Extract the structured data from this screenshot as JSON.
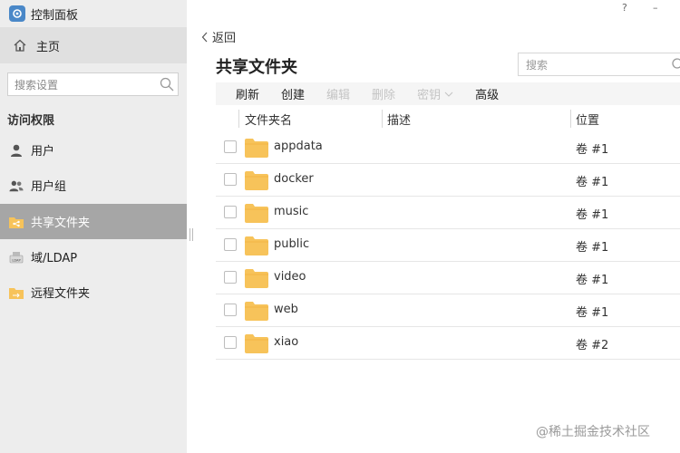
{
  "app": {
    "title": "控制面板",
    "icon": "control-panel-icon"
  },
  "sidebar": {
    "home_label": "主页",
    "search_placeholder": "搜索设置",
    "section_title": "访问权限",
    "items": [
      {
        "label": "用户",
        "icon": "user-icon",
        "active": false
      },
      {
        "label": "用户组",
        "icon": "user-group-icon",
        "active": false
      },
      {
        "label": "共享文件夹",
        "icon": "shared-folder-icon",
        "active": true
      },
      {
        "label": "域/LDAP",
        "icon": "ldap-icon",
        "active": false
      },
      {
        "label": "远程文件夹",
        "icon": "remote-folder-icon",
        "active": false
      }
    ]
  },
  "window": {
    "help": "?",
    "minimize": "–"
  },
  "main": {
    "back_label": "返回",
    "title": "共享文件夹",
    "search_placeholder": "搜索",
    "toolbar": {
      "refresh": "刷新",
      "create": "创建",
      "edit": "编辑",
      "delete": "删除",
      "key": "密钥",
      "advanced": "高级"
    },
    "columns": {
      "name": "文件夹名",
      "description": "描述",
      "location": "位置"
    },
    "rows": [
      {
        "name": "appdata",
        "description": "",
        "location": "卷 #1"
      },
      {
        "name": "docker",
        "description": "",
        "location": "卷 #1"
      },
      {
        "name": "music",
        "description": "",
        "location": "卷 #1"
      },
      {
        "name": "public",
        "description": "",
        "location": "卷 #1"
      },
      {
        "name": "video",
        "description": "",
        "location": "卷 #1"
      },
      {
        "name": "web",
        "description": "",
        "location": "卷 #1"
      },
      {
        "name": "xiao",
        "description": "",
        "location": "卷 #2"
      }
    ]
  },
  "watermark": "@稀土掘金技术社区",
  "colors": {
    "sidebar_bg": "#ededed",
    "active_item_bg": "#a6a6a6",
    "folder": "#f7c35a",
    "disabled_text": "#c4c4c4"
  }
}
